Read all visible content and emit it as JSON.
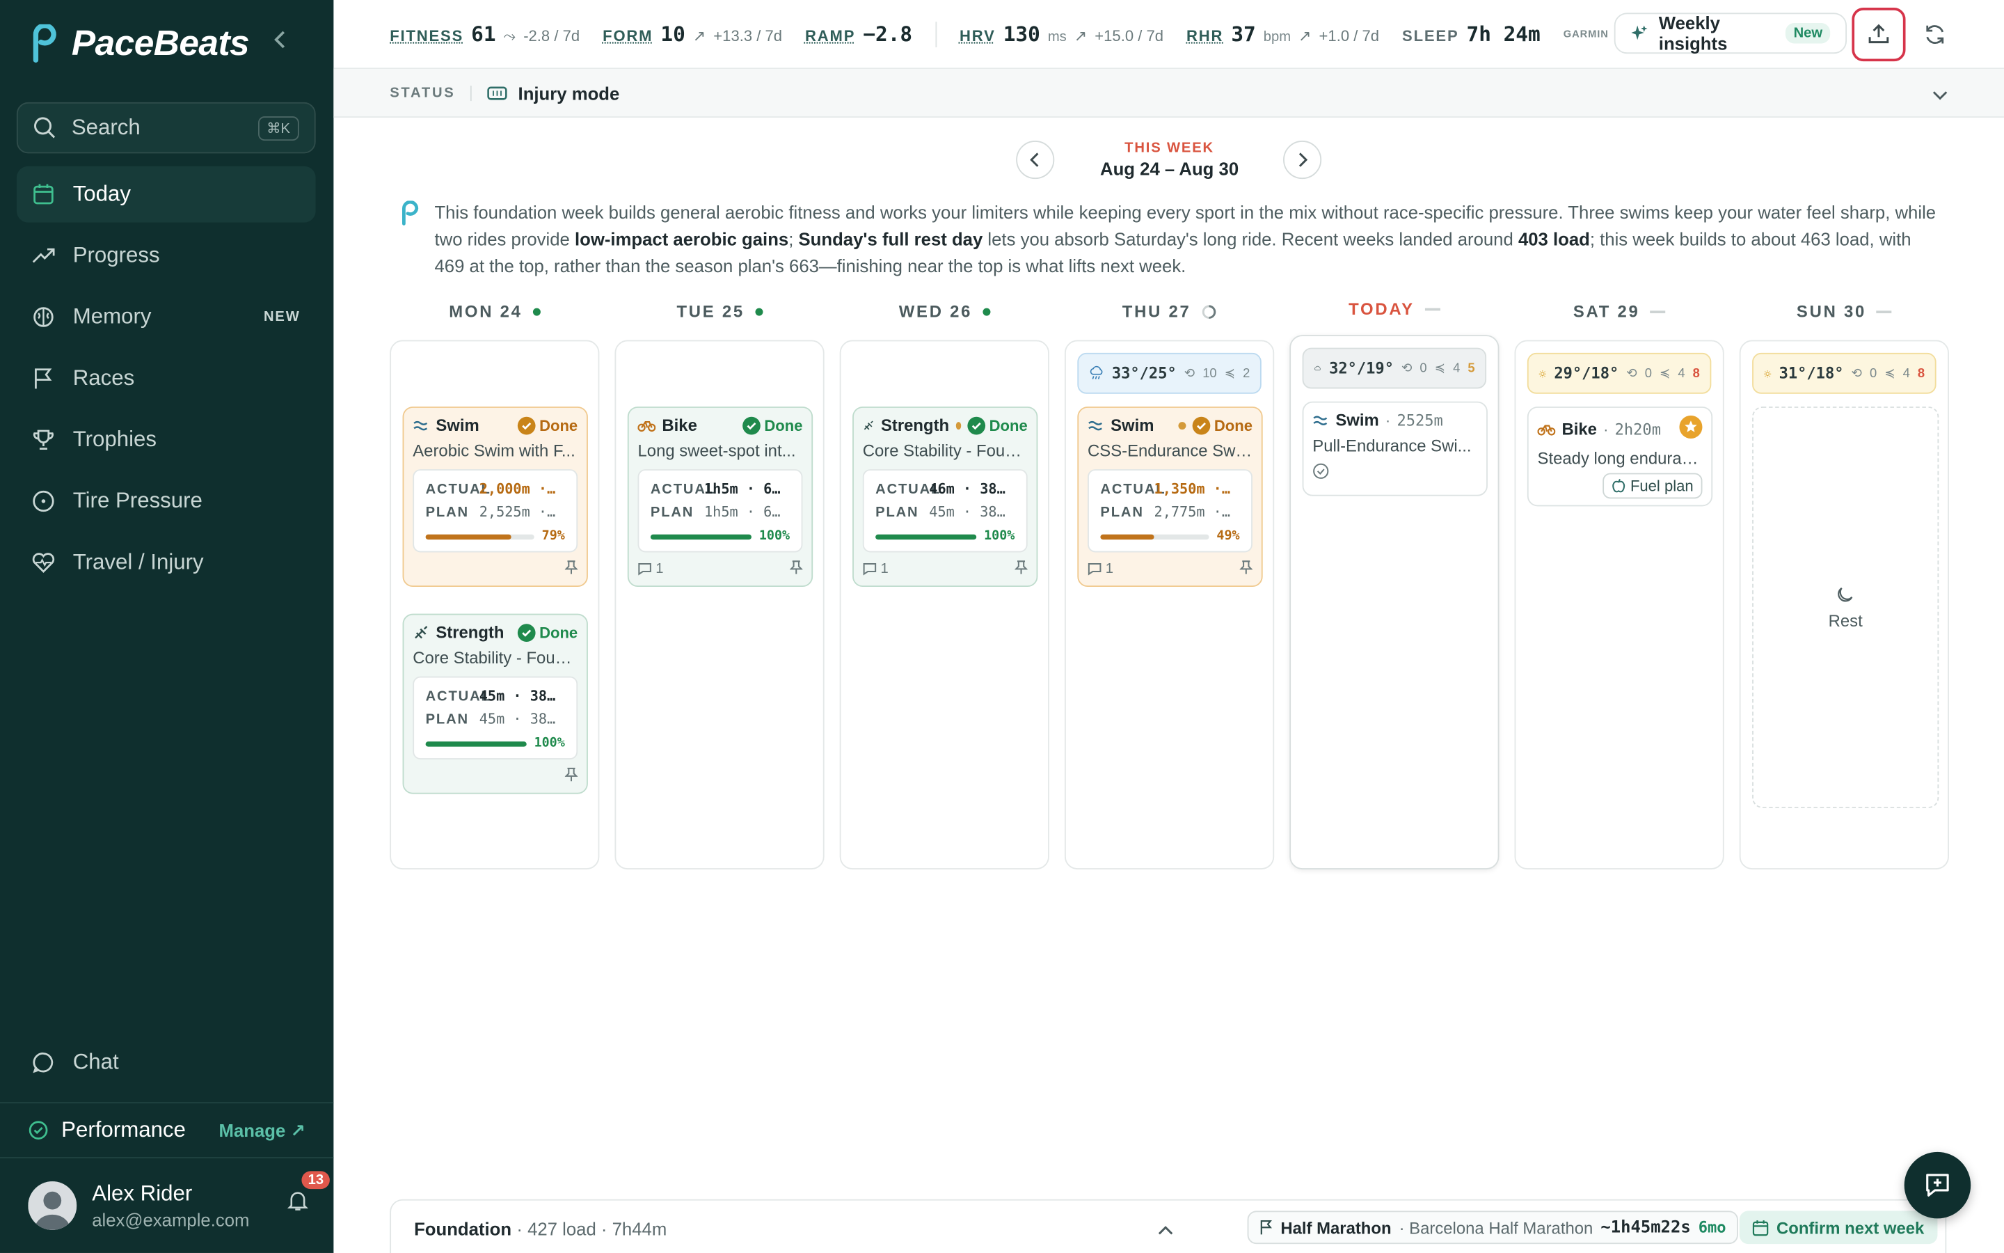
{
  "app": {
    "brand": "PaceBeats"
  },
  "sidebar": {
    "search_label": "Search",
    "search_shortcut": "⌘K",
    "items": [
      {
        "label": "Today",
        "icon": "calendar-icon"
      },
      {
        "label": "Progress",
        "icon": "trend-icon"
      },
      {
        "label": "Memory",
        "icon": "brain-icon",
        "badge": "NEW"
      },
      {
        "label": "Races",
        "icon": "flag-icon"
      },
      {
        "label": "Trophies",
        "icon": "trophy-icon"
      },
      {
        "label": "Tire Pressure",
        "icon": "gauge-icon"
      },
      {
        "label": "Travel / Injury",
        "icon": "heart-pulse-icon"
      }
    ],
    "chat_label": "Chat",
    "performance_label": "Performance",
    "manage_label": "Manage",
    "user_name": "Alex Rider",
    "user_email": "alex@example.com",
    "notifications": "13"
  },
  "topbar": {
    "fitness_label": "FITNESS",
    "fitness_value": "61",
    "fitness_delta": "-2.8 / 7d",
    "form_label": "FORM",
    "form_value": "10",
    "form_delta": "+13.3 / 7d",
    "ramp_label": "RAMP",
    "ramp_value": "−2.8",
    "hrv_label": "HRV",
    "hrv_value": "130",
    "hrv_unit": "ms",
    "hrv_delta": "+15.0 / 7d",
    "rhr_label": "RHR",
    "rhr_value": "37",
    "rhr_unit": "bpm",
    "rhr_delta": "+1.0 / 7d",
    "sleep_label": "SLEEP",
    "sleep_value": "7h 24m",
    "source": "GARMIN",
    "insights_label": "Weekly insights",
    "insights_badge": "New"
  },
  "status": {
    "label": "STATUS",
    "value": "Injury mode"
  },
  "week": {
    "label": "THIS WEEK",
    "range": "Aug 24 – Aug 30"
  },
  "summary": {
    "p1": "This foundation week builds general aerobic fitness and works your limiters while keeping every sport in the mix without race-specific pressure. Three swims keep your water feel sharp, while two rides provide ",
    "b1": "low-impact aerobic gains",
    "p2": "; ",
    "b2": "Sunday's full rest day",
    "p3": " lets you absorb Saturday's long ride. Recent weeks landed around ",
    "b3": "403 load",
    "p4": "; this week builds to about 463 load, with 469 at the top, rather than the season plan's 663—finishing near the top is what lifts next week."
  },
  "days": {
    "mon": {
      "label": "MON 24"
    },
    "tue": {
      "label": "TUE 25"
    },
    "wed": {
      "label": "WED 26"
    },
    "thu": {
      "label": "THU 27"
    },
    "fri": {
      "label": "TODAY"
    },
    "sat": {
      "label": "SAT 29"
    },
    "sun": {
      "label": "SUN 30"
    }
  },
  "weather": {
    "thu": {
      "temp": "33°/25°",
      "w1": "10",
      "w2": "2"
    },
    "fri": {
      "temp": "32°/19°",
      "w1": "0",
      "w2": "4",
      "aqi": "5"
    },
    "sat": {
      "temp": "29°/18°",
      "w1": "0",
      "w2": "4",
      "aqi": "8"
    },
    "sun": {
      "temp": "31°/18°",
      "w1": "0",
      "w2": "4",
      "aqi": "8"
    }
  },
  "workouts": {
    "mon1": {
      "sport": "Swim",
      "status": "Done",
      "title": "Aerobic Swim with F...",
      "actual": "2,000m ·…",
      "plan": "2,525m ·…",
      "pct": "79%",
      "progress": 0.79
    },
    "mon2": {
      "sport": "Strength",
      "status": "Done",
      "title": "Core Stability - Foun...",
      "actual": "45m · 38…",
      "plan": "45m · 38…",
      "pct": "100%",
      "progress": 1.0
    },
    "tue1": {
      "sport": "Bike",
      "status": "Done",
      "title": "Long sweet-spot int...",
      "actual": "1h5m · 6…",
      "plan": "1h5m · 6…",
      "pct": "100%",
      "progress": 1.0,
      "comments": "1"
    },
    "wed1": {
      "sport": "Strength",
      "status": "Done",
      "title": "Core Stability - Foun...",
      "actual": "46m · 38…",
      "plan": "45m · 38…",
      "pct": "100%",
      "progress": 1.0,
      "comments": "1"
    },
    "thu1": {
      "sport": "Swim",
      "status": "Done",
      "title": "CSS-Endurance Swim",
      "actual": "1,350m ·…",
      "plan": "2,775m ·…",
      "pct": "49%",
      "progress": 0.49,
      "comments": "1"
    },
    "fri1": {
      "sport": "Swim",
      "meta": "2525m",
      "title": "Pull-Endurance Swi..."
    },
    "sat1": {
      "sport": "Bike",
      "meta": "2h20m",
      "title": "Steady long enduran...",
      "fuel": "Fuel plan"
    },
    "sun_rest": "Rest"
  },
  "labels": {
    "actual": "ACTUAL",
    "plan": "PLAN"
  },
  "bottom": {
    "phase": "Foundation",
    "meta": "· 427 load · 7h44m",
    "race_type": "Half Marathon",
    "race_name": "· Barcelona Half Marathon",
    "race_time": "~1h45m22s",
    "race_when": "6mo",
    "confirm_label": "Confirm next week"
  },
  "colors": {
    "accent": "#d9543f",
    "sidebar_bg": "#0f2f2e",
    "done_green": "#1f8a4c",
    "done_orange": "#b66a12"
  }
}
